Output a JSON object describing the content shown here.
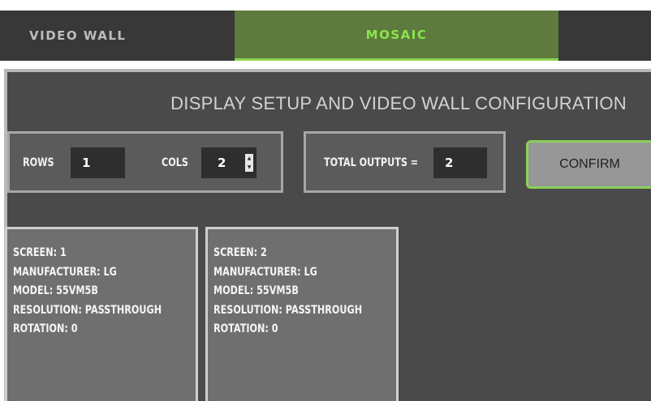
{
  "tabs": [
    {
      "label": "VIDEO WALL",
      "active": false
    },
    {
      "label": "MOSAIC",
      "active": true
    }
  ],
  "panel": {
    "title": "DISPLAY SETUP AND VIDEO WALL CONFIGURATION"
  },
  "grid": {
    "rows_label": "ROWS",
    "rows_value": "1",
    "cols_label": "COLS",
    "cols_value": "2"
  },
  "total": {
    "label": "TOTAL OUTPUTS =",
    "value": "2"
  },
  "confirm_label": "CONFIRM",
  "screens": [
    {
      "screen": "SCREEN: 1",
      "manufacturer": "MANUFACTURER: LG",
      "model": "MODEL: 55VM5B",
      "resolution": "RESOLUTION: PASSTHROUGH",
      "rotation": "ROTATION: 0"
    },
    {
      "screen": "SCREEN: 2",
      "manufacturer": "MANUFACTURER: LG",
      "model": "MODEL: 55VM5B",
      "resolution": "RESOLUTION: PASSTHROUGH",
      "rotation": "ROTATION: 0"
    }
  ],
  "colors": {
    "accent_green": "#88e54c",
    "active_tab_bg": "#5f7a3e",
    "panel_bg": "#4a4a4a"
  }
}
